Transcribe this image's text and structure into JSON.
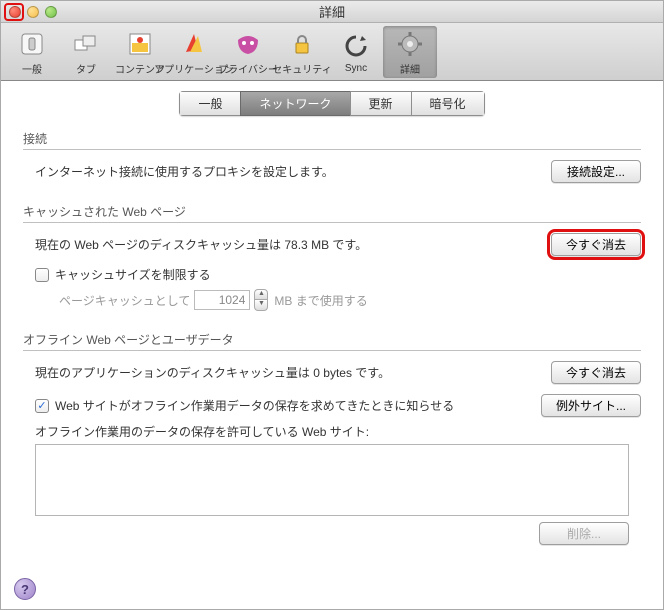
{
  "window": {
    "title": "詳細"
  },
  "toolbar": {
    "items": [
      {
        "label": "一般"
      },
      {
        "label": "タブ"
      },
      {
        "label": "コンテンツ"
      },
      {
        "label": "アプリケーション"
      },
      {
        "label": "プライバシー"
      },
      {
        "label": "セキュリティ"
      },
      {
        "label": "Sync"
      },
      {
        "label": "詳細"
      }
    ]
  },
  "subtabs": {
    "general": "一般",
    "network": "ネットワーク",
    "update": "更新",
    "encryption": "暗号化"
  },
  "connection": {
    "header": "接続",
    "text": "インターネット接続に使用するプロキシを設定します。",
    "settings_btn": "接続設定..."
  },
  "cache": {
    "header": "キャッシュされた Web ページ",
    "text": "現在の Web ページのディスクキャッシュ量は 78.3 MB です。",
    "clear_btn": "今すぐ消去",
    "limit_label": "キャッシュサイズを制限する",
    "page_cache_label": "ページキャッシュとして",
    "page_cache_value": "1024",
    "page_cache_suffix": "MB まで使用する"
  },
  "offline": {
    "header": "オフライン Web ページとユーザデータ",
    "text": "現在のアプリケーションのディスクキャッシュ量は 0 bytes です。",
    "clear_btn": "今すぐ消去",
    "notify_label": "Web サイトがオフライン作業用データの保存を求めてきたときに知らせる",
    "exceptions_btn": "例外サイト...",
    "allowed_label": "オフライン作業用のデータの保存を許可している Web サイト:",
    "delete_btn": "削除..."
  },
  "help": "?"
}
